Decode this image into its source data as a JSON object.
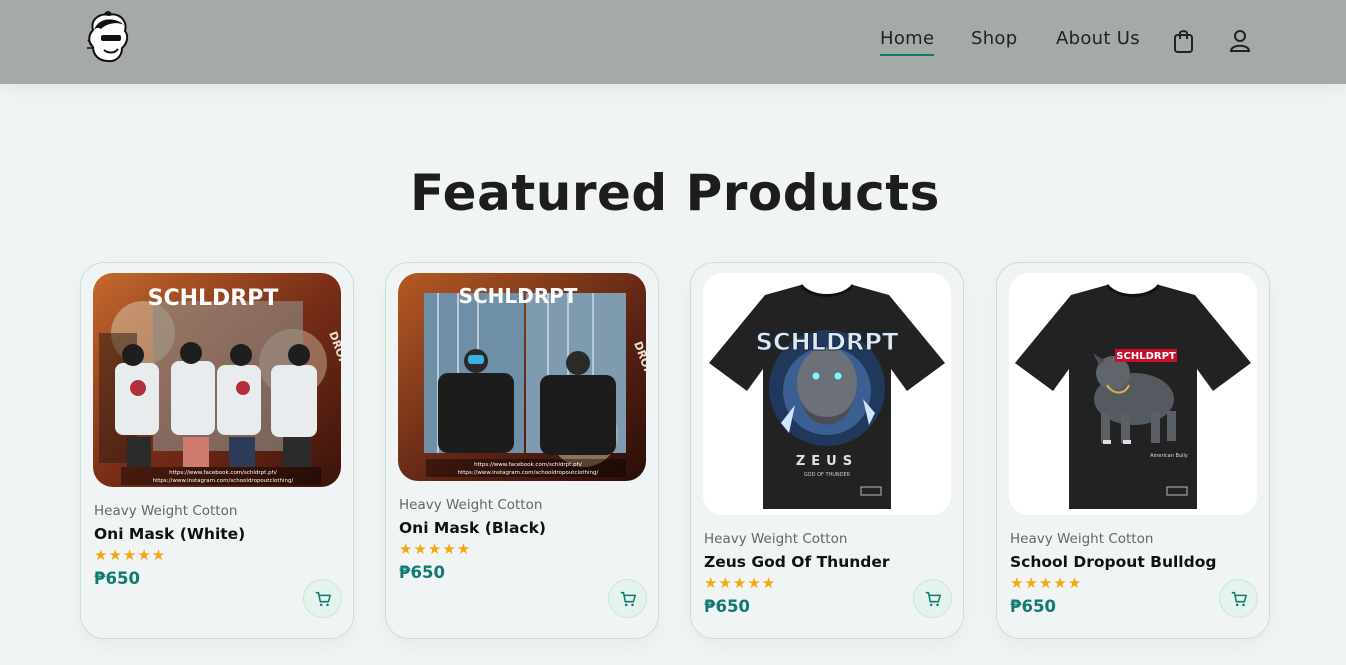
{
  "header": {
    "logo_icon": "brand-mascot-logo",
    "nav": [
      {
        "label": "Home",
        "active": true
      },
      {
        "label": "Shop",
        "active": false
      },
      {
        "label": "About Us",
        "active": false
      }
    ],
    "bag_icon": "shopping-bag-icon",
    "user_icon": "user-icon"
  },
  "featured": {
    "title": "Featured Products",
    "products": [
      {
        "brand": "Heavy Weight Cotton",
        "name": "Oni Mask (White)",
        "rating": 5,
        "stars": "★★★★★",
        "price": "₱650",
        "image": {
          "wordmark": "SCHLDRPT",
          "side_text": "DROPOUT",
          "links": [
            "https://www.facebook.com/schldrpt.ph/",
            "https://www.instagram.com/schooldropoutclothing/"
          ]
        },
        "cart_icon": "cart-icon"
      },
      {
        "brand": "Heavy Weight Cotton",
        "name": "Oni Mask (Black)",
        "rating": 5,
        "stars": "★★★★★",
        "price": "₱650",
        "image": {
          "wordmark": "SCHLDRPT",
          "side_text": "DROPOUT",
          "links": [
            "https://www.facebook.com/schldrpt.ph/",
            "https://www.instagram.com/schooldropoutclothing/"
          ]
        },
        "cart_icon": "cart-icon"
      },
      {
        "brand": "Heavy Weight Cotton",
        "name": "Zeus God Of Thunder",
        "rating": 5,
        "stars": "★★★★★",
        "price": "₱650",
        "image": {
          "wordmark": "SCHLDRPT",
          "print_title": "ZEUS",
          "print_subtitle": "GOD OF THUNDER"
        },
        "cart_icon": "cart-icon"
      },
      {
        "brand": "Heavy Weight Cotton",
        "name": "School Dropout Bulldog",
        "rating": 5,
        "stars": "★★★★★",
        "price": "₱650",
        "image": {
          "wordmark": "SCHLDRPT",
          "print_caption": "American Bully"
        },
        "cart_icon": "cart-icon"
      }
    ]
  },
  "colors": {
    "header_bg": "#a6aaa6",
    "page_bg": "#f1f4f4",
    "accent": "#0f7a72",
    "star": "#f3a80f",
    "card_border": "#c6e2d6"
  }
}
